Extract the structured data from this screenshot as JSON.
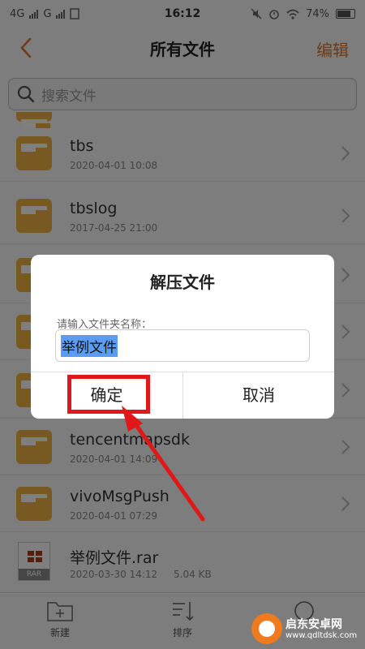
{
  "status_bar": {
    "left_icons": [
      "4G",
      "G"
    ],
    "time": "16:12",
    "battery": "74%"
  },
  "header": {
    "title": "所有文件",
    "edit_label": "编辑"
  },
  "search": {
    "placeholder": "搜索文件"
  },
  "files": [
    {
      "name": "tbs",
      "date": "2020-04-01 10:08",
      "size": "",
      "type": "folder"
    },
    {
      "name": "tbslog",
      "date": "2017-04-25 21:00",
      "size": "",
      "type": "folder"
    },
    {
      "name": "",
      "date": "",
      "size": "",
      "type": "folder"
    },
    {
      "name": "",
      "date": "",
      "size": "",
      "type": "folder"
    },
    {
      "name": "",
      "date": "",
      "size": "",
      "type": "folder"
    },
    {
      "name": "tencentmapsdk",
      "date": "2020-04-01 14:09",
      "size": "",
      "type": "folder"
    },
    {
      "name": "vivoMsgPush",
      "date": "2020-04-01 07:29",
      "size": "",
      "type": "folder"
    },
    {
      "name": "举例文件.rar",
      "date": "2020-03-30 14:12",
      "size": "5.04 KB",
      "type": "rar",
      "badge": "RAR"
    }
  ],
  "bottom_bar": {
    "new_label": "新建",
    "sort_label": "排序"
  },
  "dialog": {
    "title": "解压文件",
    "prompt": "请输入文件夹名称：",
    "input_value": "举例文件",
    "ok_label": "确定",
    "cancel_label": "取消"
  },
  "watermark": {
    "title": "启东安卓网",
    "url": "www.qdltdsk.com"
  },
  "colors": {
    "accent": "#e0762a",
    "folder": "#f1b343",
    "highlight": "#e01818",
    "selection": "#5b9cf3"
  }
}
